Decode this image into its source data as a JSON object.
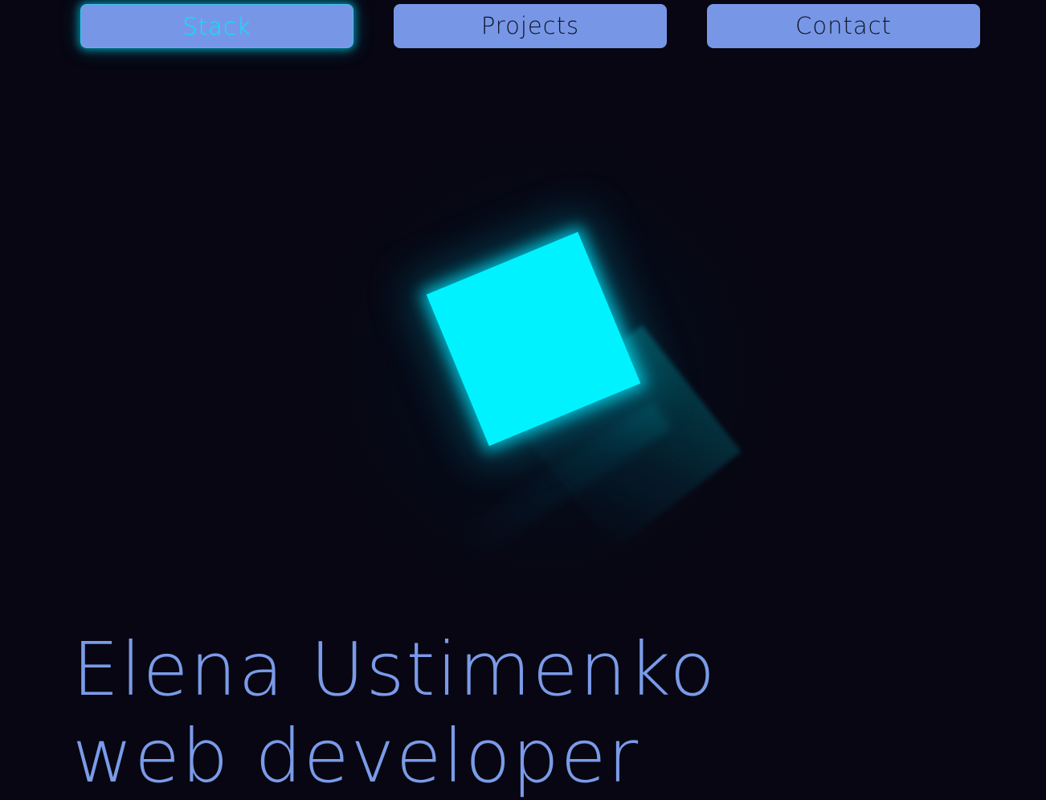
{
  "nav": {
    "stack_label": "Stack",
    "projects_label": "Projects",
    "contact_label": "Contact",
    "active_tab": "Stack"
  },
  "hero": {
    "name": "Elena Ustimenko",
    "role": "web developer"
  },
  "colors": {
    "background": "#070612",
    "nav_button": "#7797e6",
    "active_text": "#00e8ff",
    "cube": "#00f2ff",
    "headline": "#7a9be8"
  }
}
